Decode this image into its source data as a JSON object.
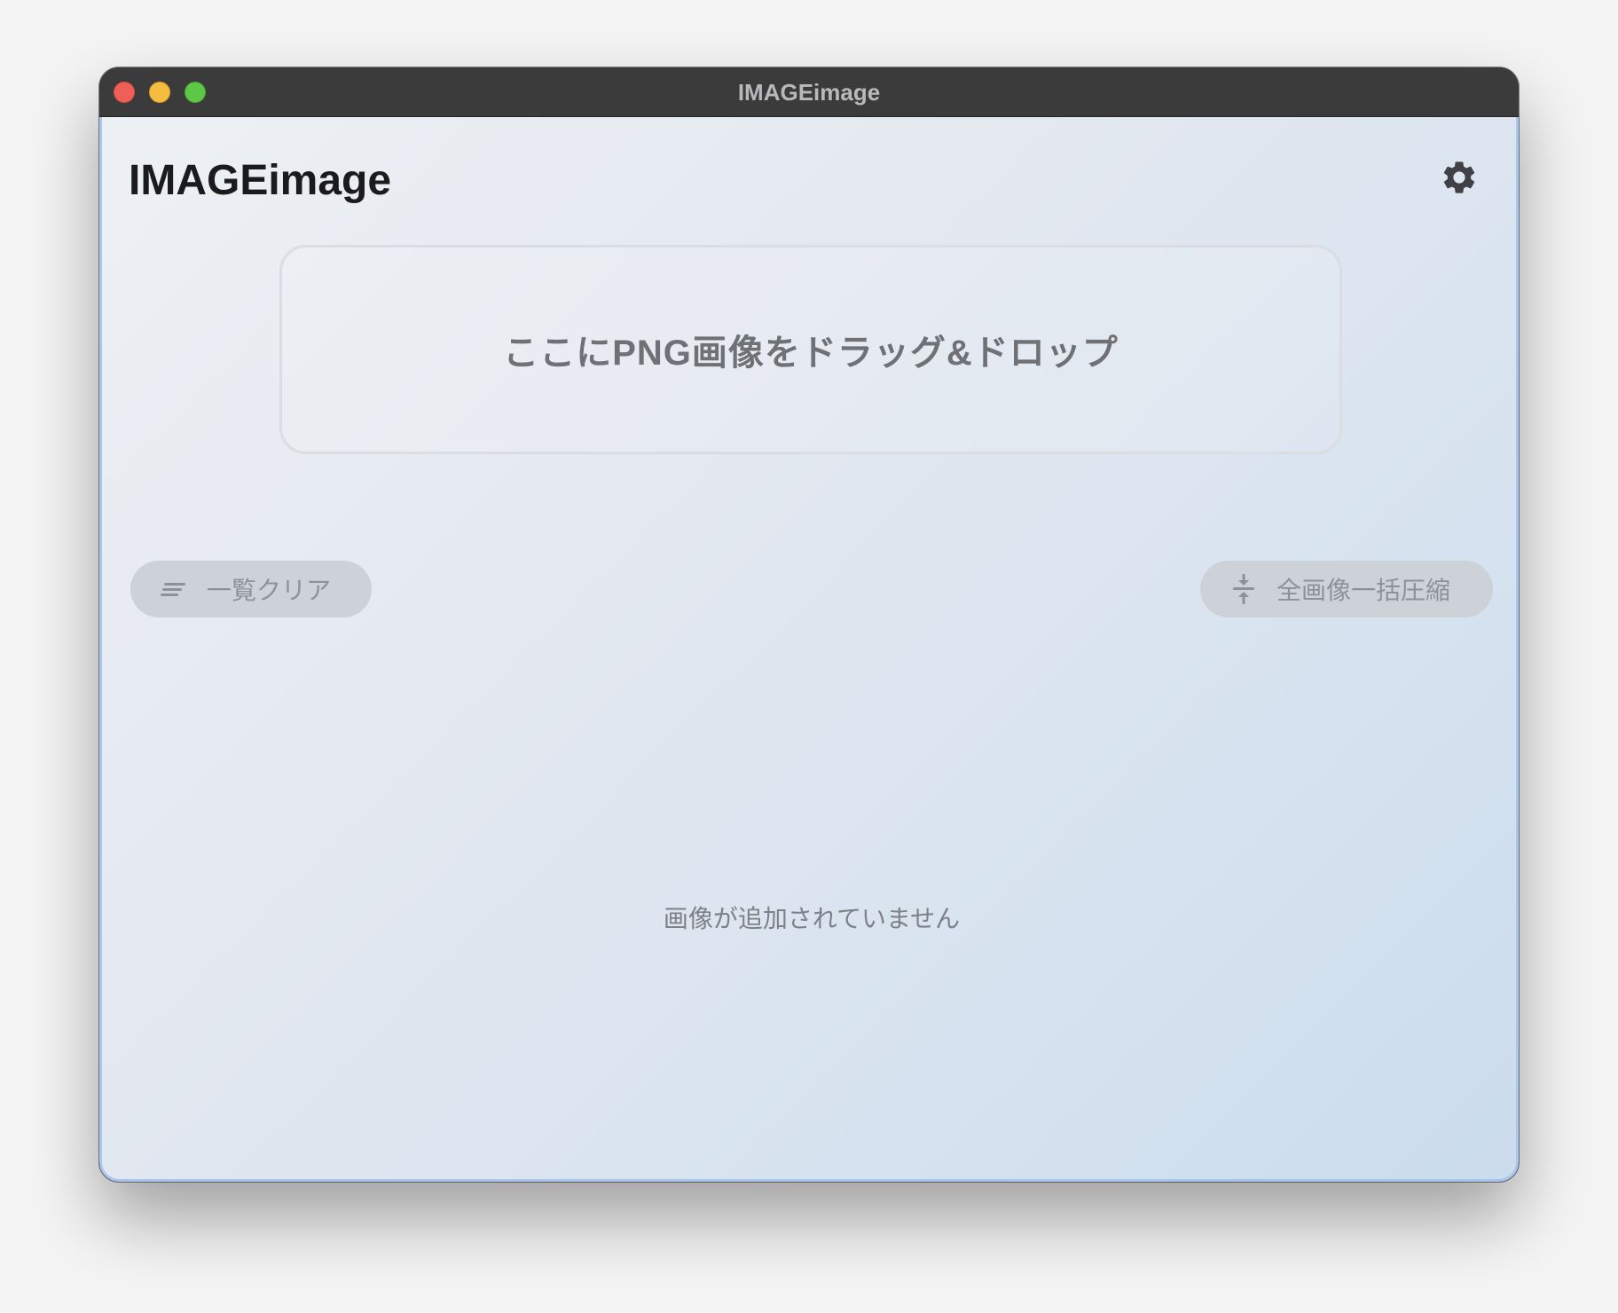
{
  "window": {
    "title": "IMAGEimage"
  },
  "header": {
    "app_title": "IMAGEimage",
    "settings_icon": "gear-icon"
  },
  "dropzone": {
    "label": "ここにPNG画像をドラッグ&ドロップ"
  },
  "actions": {
    "clear_label": "一覧クリア",
    "clear_icon": "clear-list-icon",
    "compress_all_label": "全画像一括圧縮",
    "compress_icon": "compress-icon"
  },
  "list": {
    "empty_message": "画像が追加されていません"
  },
  "colors": {
    "accent_border": "#a9c6ee",
    "close": "#ee5f57",
    "minimize": "#f5bd3d",
    "maximize": "#5ec748"
  }
}
